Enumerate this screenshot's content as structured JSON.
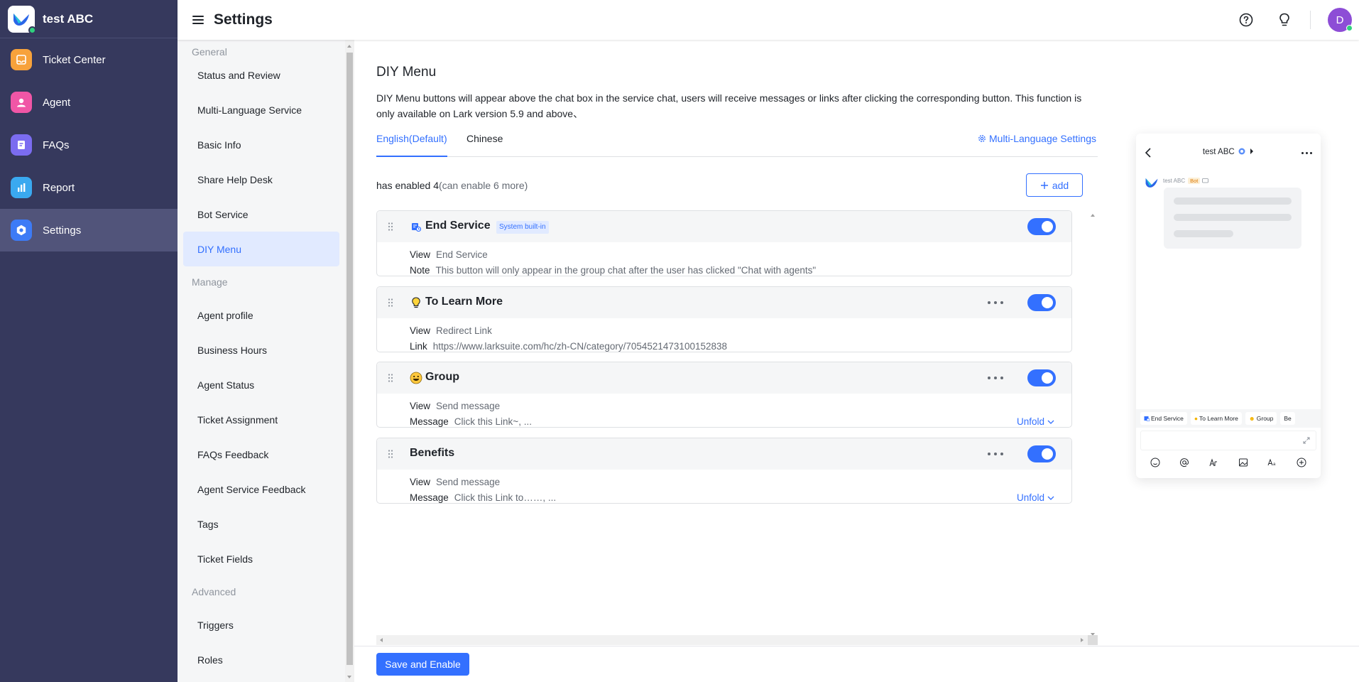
{
  "app": {
    "name": "test ABC",
    "page_title": "Settings",
    "avatar_initial": "D"
  },
  "nav": [
    {
      "label": "Ticket Center",
      "icon": "ticket-icon",
      "color": "#f7a23b",
      "active": false
    },
    {
      "label": "Agent",
      "icon": "agent-icon",
      "color": "#f056a6",
      "active": false
    },
    {
      "label": "FAQs",
      "icon": "faq-icon",
      "color": "#7b6cf0",
      "active": false
    },
    {
      "label": "Report",
      "icon": "report-icon",
      "color": "#3aa9f0",
      "active": false
    },
    {
      "label": "Settings",
      "icon": "settings-icon",
      "color": "#3d7bf6",
      "active": true
    }
  ],
  "submenu": {
    "groups": [
      {
        "title": "General",
        "items": [
          "Status and Review",
          "Multi-Language Service",
          "Basic Info",
          "Share Help Desk",
          "Bot Service",
          "DIY Menu"
        ]
      },
      {
        "title": "Manage",
        "items": [
          "Agent profile",
          "Business Hours",
          "Agent Status",
          "Ticket Assignment",
          "FAQs Feedback",
          "Agent Service Feedback",
          "Tags",
          "Ticket Fields"
        ]
      },
      {
        "title": "Advanced",
        "items": [
          "Triggers",
          "Roles"
        ]
      }
    ],
    "active": "DIY Menu"
  },
  "main": {
    "title": "DIY Menu",
    "description": "DIY Menu buttons will appear above the chat box in the service chat, users will receive messages or links after clicking the corresponding button. This function is only available on Lark version 5.9 and above、",
    "tabs": [
      "English(Default)",
      "Chinese"
    ],
    "active_tab": "English(Default)",
    "multi_language_link": "Multi-Language Settings",
    "enabled_prefix": "has enabled ",
    "enabled_count": "4",
    "enabled_more": "(can enable 6 more)",
    "add_label": "add",
    "save_label": "Save and Enable"
  },
  "cards": [
    {
      "title": "End Service",
      "icon": "end-service-icon",
      "badge": "System built-in",
      "enabled": true,
      "has_more": false,
      "rows": [
        {
          "label": "View",
          "value": "End Service"
        },
        {
          "label": "Note",
          "value": "This button will only appear in the group chat after the user has clicked \"Chat with agents\""
        }
      ],
      "unfold": ""
    },
    {
      "title": "To Learn More",
      "icon": "lightbulb-icon",
      "badge": "",
      "enabled": true,
      "has_more": true,
      "rows": [
        {
          "label": "View",
          "value": "Redirect Link"
        },
        {
          "label": "Link",
          "value": "https://www.larksuite.com/hc/zh-CN/category/7054521473100152838"
        }
      ],
      "unfold": ""
    },
    {
      "title": "Group",
      "icon": "smile-emoji-icon",
      "badge": "",
      "enabled": true,
      "has_more": true,
      "rows": [
        {
          "label": "View",
          "value": "Send message"
        },
        {
          "label": "Message",
          "value": "Click this Link~, ..."
        }
      ],
      "unfold": "Unfold"
    },
    {
      "title": "Benefits",
      "icon": "",
      "badge": "",
      "enabled": true,
      "has_more": true,
      "rows": [
        {
          "label": "View",
          "value": "Send message"
        },
        {
          "label": "Message",
          "value": "Click this Link to……, ..."
        }
      ],
      "unfold": "Unfold"
    }
  ],
  "preview": {
    "title": "test ABC",
    "sender": "test ABC",
    "sender_tag": "Bot",
    "buttons": [
      "End Service",
      "To Learn More",
      "Group",
      "Be"
    ]
  },
  "colors": {
    "accent": "#3370ff",
    "nav_bg": "#36395d"
  }
}
